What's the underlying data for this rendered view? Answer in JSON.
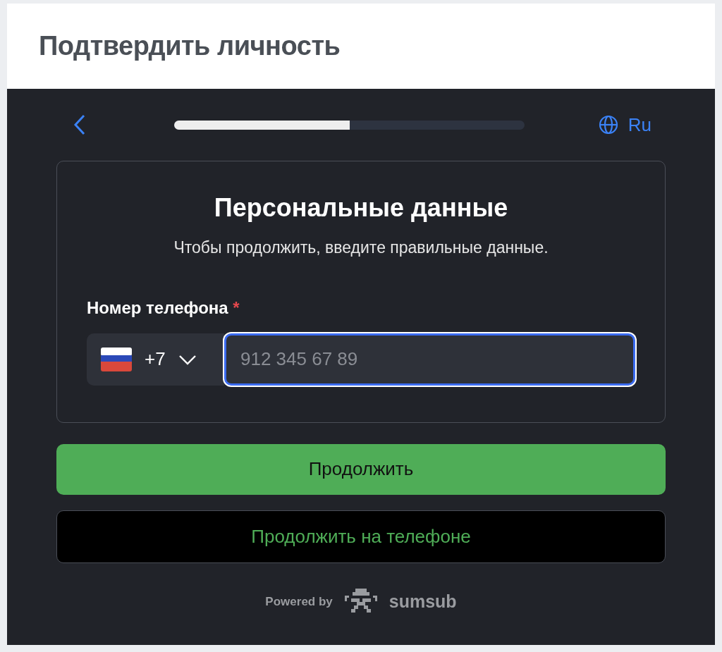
{
  "header": {
    "title": "Подтвердить личность"
  },
  "topbar": {
    "progress": {
      "level": 0.5
    },
    "language": "Ru"
  },
  "form": {
    "title": "Персональные данные",
    "subtitle": "Чтобы продолжить, введите правильные данные.",
    "phone": {
      "label": "Номер телефона",
      "required_mark": "*",
      "country_code": "+7",
      "placeholder": "912 345 67 89",
      "focused": true
    }
  },
  "buttons": [
    {
      "label": "Продолжить",
      "kind": "primary"
    },
    {
      "label": "Продолжить на телефоне",
      "kind": "secondary"
    }
  ],
  "footer": {
    "powered_by": "Powered by",
    "brand": "sumsub"
  }
}
